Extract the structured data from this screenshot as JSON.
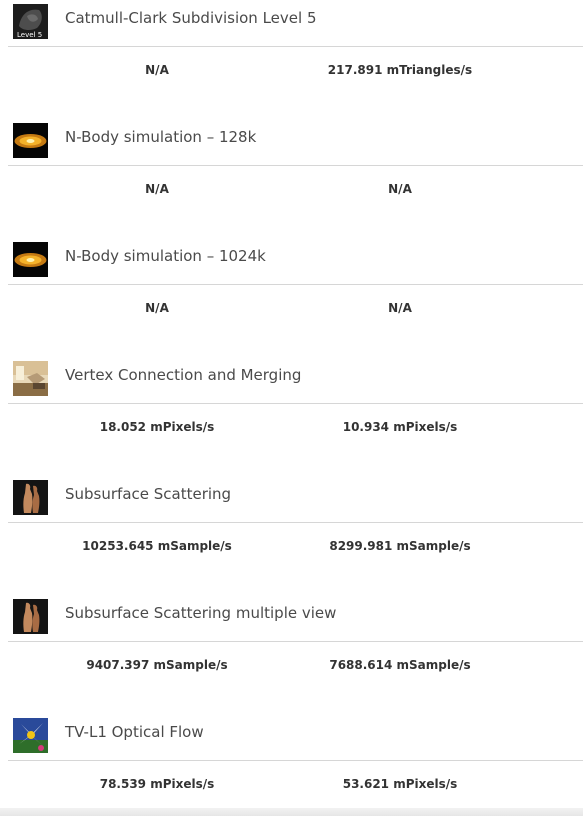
{
  "benchmarks": [
    {
      "title": "Catmull-Clark Subdivision Level 5",
      "thumb_icon": "subdivision-level5-thumbnail",
      "thumb_text": "Level 5",
      "col1": "N/A",
      "col2": "217.891 mTriangles/s"
    },
    {
      "title": "N-Body simulation – 128k",
      "thumb_icon": "galaxy-thumbnail",
      "col1": "N/A",
      "col2": "N/A"
    },
    {
      "title": "N-Body simulation – 1024k",
      "thumb_icon": "galaxy-thumbnail",
      "col1": "N/A",
      "col2": "N/A"
    },
    {
      "title": "Vertex Connection and Merging",
      "thumb_icon": "room-render-thumbnail",
      "col1": "18.052 mPixels/s",
      "col2": "10.934 mPixels/s"
    },
    {
      "title": "Subsurface Scattering",
      "thumb_icon": "statue-thumbnail",
      "col1": "10253.645 mSample/s",
      "col2": "8299.981 mSample/s"
    },
    {
      "title": "Subsurface Scattering multiple view",
      "thumb_icon": "statue-thumbnail",
      "col1": "9407.397 mSample/s",
      "col2": "7688.614 mSample/s"
    },
    {
      "title": "TV-L1 Optical Flow",
      "thumb_icon": "flower-thumbnail",
      "col1": "78.539 mPixels/s",
      "col2": "53.621 mPixels/s"
    }
  ]
}
